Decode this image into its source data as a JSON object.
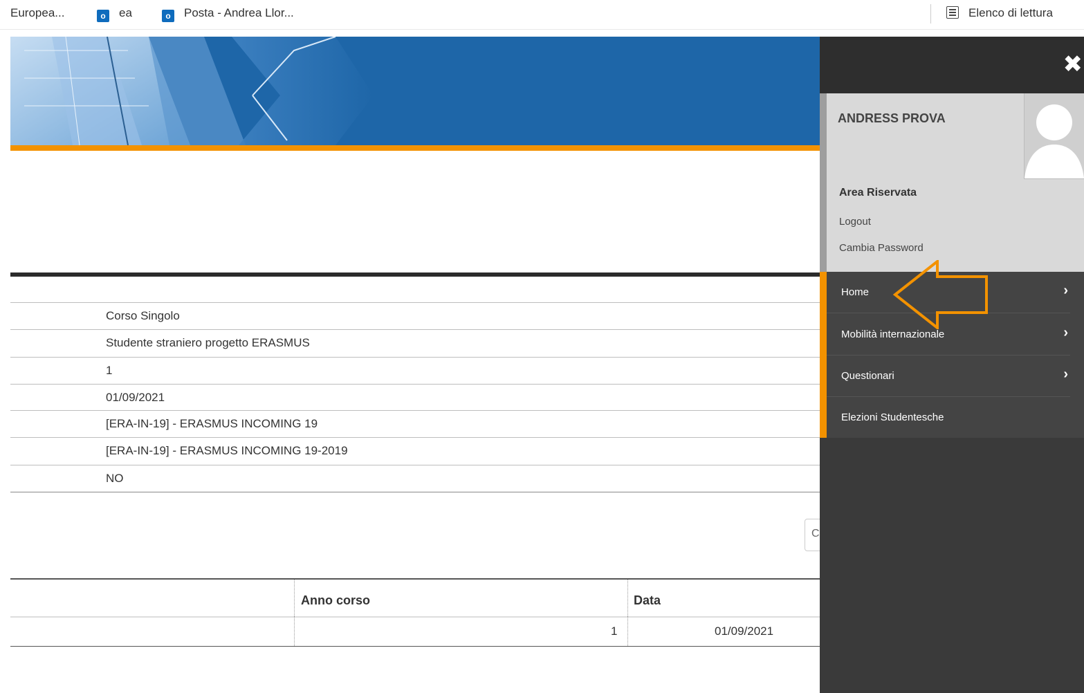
{
  "bookmarks": [
    {
      "label": "Europea..."
    },
    {
      "label": "ea",
      "icon": "outlook-icon"
    },
    {
      "label": "Posta - Andrea Llor...",
      "icon": "outlook-icon"
    }
  ],
  "reading_list": {
    "label": "Elenco di lettura",
    "icon": "reading-list-icon"
  },
  "details": {
    "rows": [
      "Corso Singolo",
      "Studente straniero progetto ERASMUS",
      "1",
      "01/09/2021",
      "[ERA-IN-19] - ERASMUS INCOMING 19",
      "[ERA-IN-19] - ERASMUS INCOMING 19-2019",
      "NO"
    ]
  },
  "search_stub": {
    "text": "C"
  },
  "table": {
    "headers": [
      "",
      "Anno corso",
      "Data"
    ],
    "rows": [
      [
        "",
        "1",
        "01/09/2021"
      ]
    ]
  },
  "sidebar": {
    "close_icon": "close-icon",
    "user_name": "ANDRESS PROVA",
    "section_title": "Area Riservata",
    "links": [
      "Logout",
      "Cambia Password"
    ],
    "menu": [
      {
        "label": "Home",
        "has_chevron": true
      },
      {
        "label": "Mobilità internazionale",
        "has_chevron": true
      },
      {
        "label": "Questionari",
        "has_chevron": true
      },
      {
        "label": "Elezioni Studentesche",
        "has_chevron": false
      }
    ]
  },
  "colors": {
    "accent_orange": "#f39200",
    "banner_blue": "#1e66a8",
    "sidebar_dark": "#3a3a3a"
  }
}
